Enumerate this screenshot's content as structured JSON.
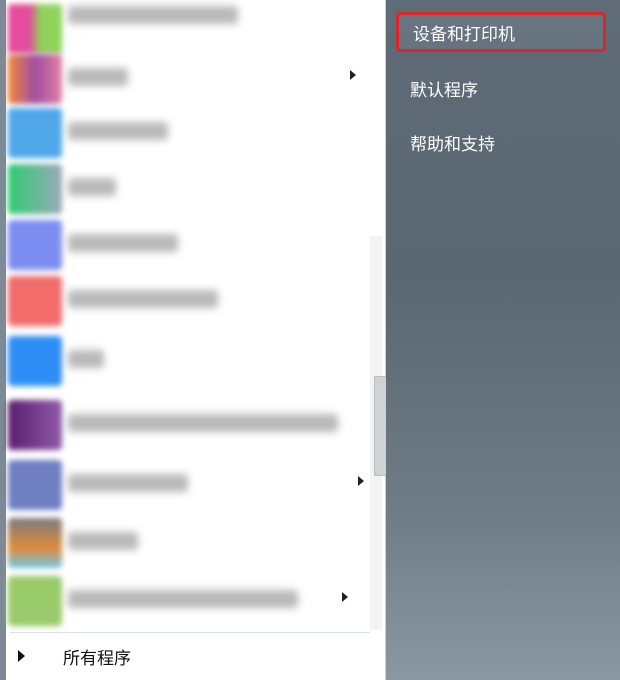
{
  "right_menu": {
    "items": [
      {
        "label": "设备和打印机"
      },
      {
        "label": "默认程序"
      },
      {
        "label": "帮助和支持"
      }
    ]
  },
  "all_programs": {
    "label": "所有程序"
  },
  "colors": {
    "highlight_border": "#d9262b",
    "right_panel_bg": "#5c6b78",
    "left_panel_bg": "#ffffff"
  }
}
